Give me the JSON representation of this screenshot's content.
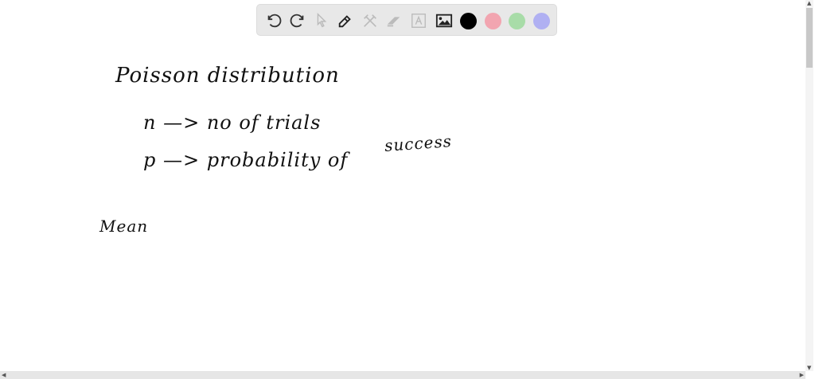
{
  "toolbar": {
    "tools": [
      {
        "name": "undo-icon",
        "enabled": true
      },
      {
        "name": "redo-icon",
        "enabled": true
      },
      {
        "name": "select-icon",
        "enabled": false
      },
      {
        "name": "pen-icon",
        "enabled": true
      },
      {
        "name": "tools-icon",
        "enabled": false
      },
      {
        "name": "eraser-icon",
        "enabled": false
      },
      {
        "name": "text-icon",
        "enabled": false
      },
      {
        "name": "image-icon",
        "enabled": true
      }
    ],
    "colors": [
      "#000000",
      "#f2a5b0",
      "#a8dca8",
      "#b0b0f2"
    ]
  },
  "canvas": {
    "title": "Poisson distribution",
    "line1": "n —> no of trials",
    "line2": "p —> probability of",
    "line2b": "success",
    "mean": "Mean"
  }
}
